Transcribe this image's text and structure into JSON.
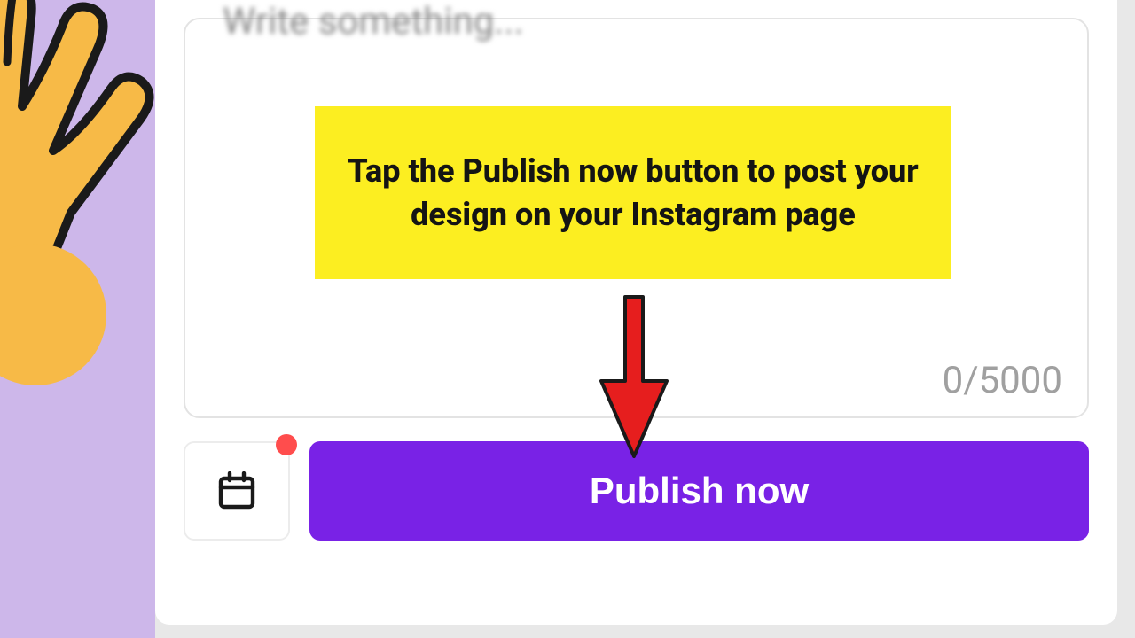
{
  "caption": {
    "placeholder": "Write something...",
    "counter": "0/5000"
  },
  "actions": {
    "schedule_badge": true,
    "publish_label": "Publish now"
  },
  "annotation": {
    "callout_text": "Tap the Publish now button to post your design on your Instagram page"
  }
}
